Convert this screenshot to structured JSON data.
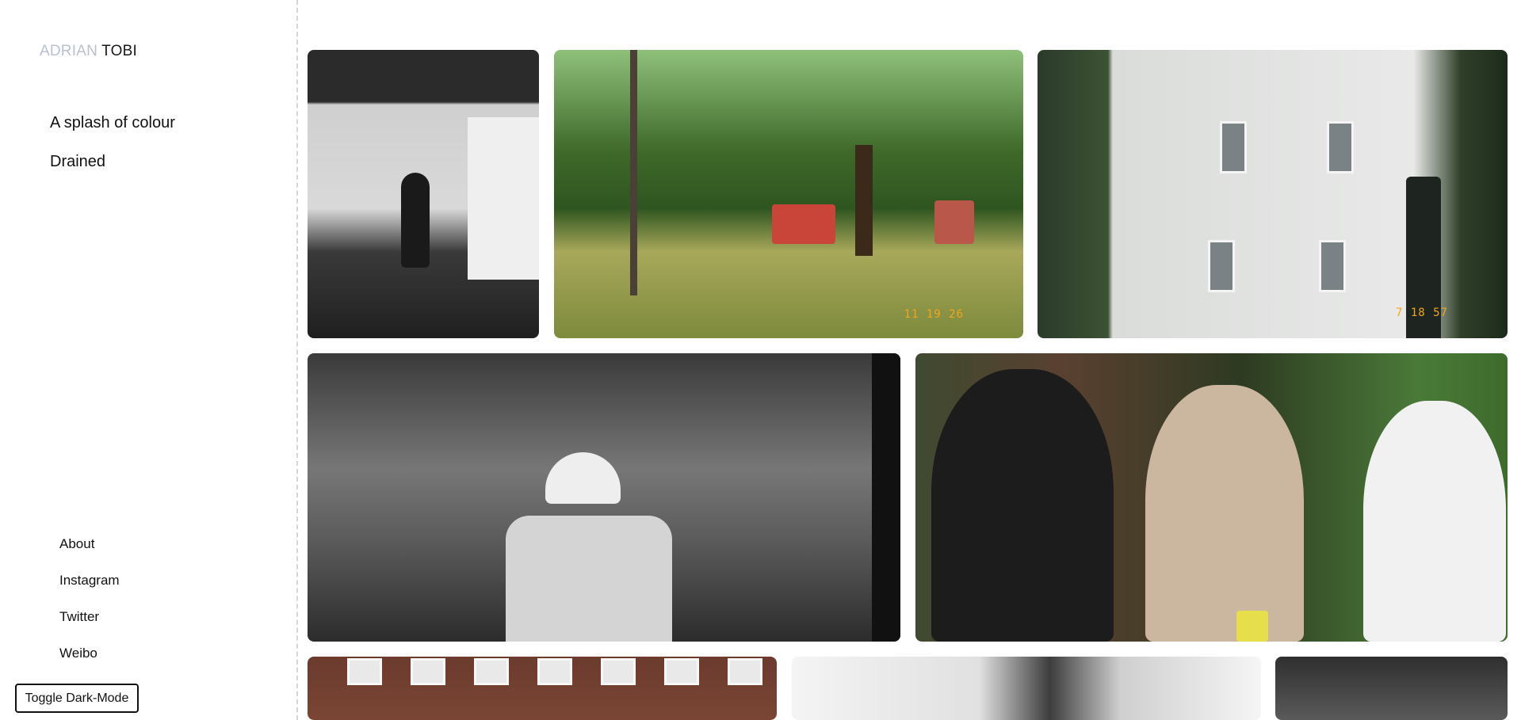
{
  "logo": {
    "first": "ADRIAN",
    "last": "TOBI"
  },
  "collections": [
    {
      "label": "A splash of colour"
    },
    {
      "label": "Drained"
    }
  ],
  "social": [
    {
      "label": "About"
    },
    {
      "label": "Instagram"
    },
    {
      "label": "Twitter"
    },
    {
      "label": "Weibo"
    }
  ],
  "toggle": {
    "label": "Toggle Dark-Mode"
  },
  "photos": [
    {
      "kind": "bw",
      "subject": "person-dancing"
    },
    {
      "kind": "color",
      "subject": "park-playground",
      "stamp": "11 19 26"
    },
    {
      "kind": "color",
      "subject": "white-building",
      "stamp": "7 18 57"
    },
    {
      "kind": "bw",
      "subject": "construction-worker"
    },
    {
      "kind": "color",
      "subject": "friends-garden"
    },
    {
      "kind": "color",
      "subject": "brick-building"
    },
    {
      "kind": "bw",
      "subject": "blurred-figure"
    },
    {
      "kind": "bw",
      "subject": "dark-wall"
    }
  ],
  "colors": {
    "logo_first": "#b9c2cc",
    "text": "#111111",
    "divider": "#d4d4d4",
    "stamp": "#f2a51a"
  }
}
